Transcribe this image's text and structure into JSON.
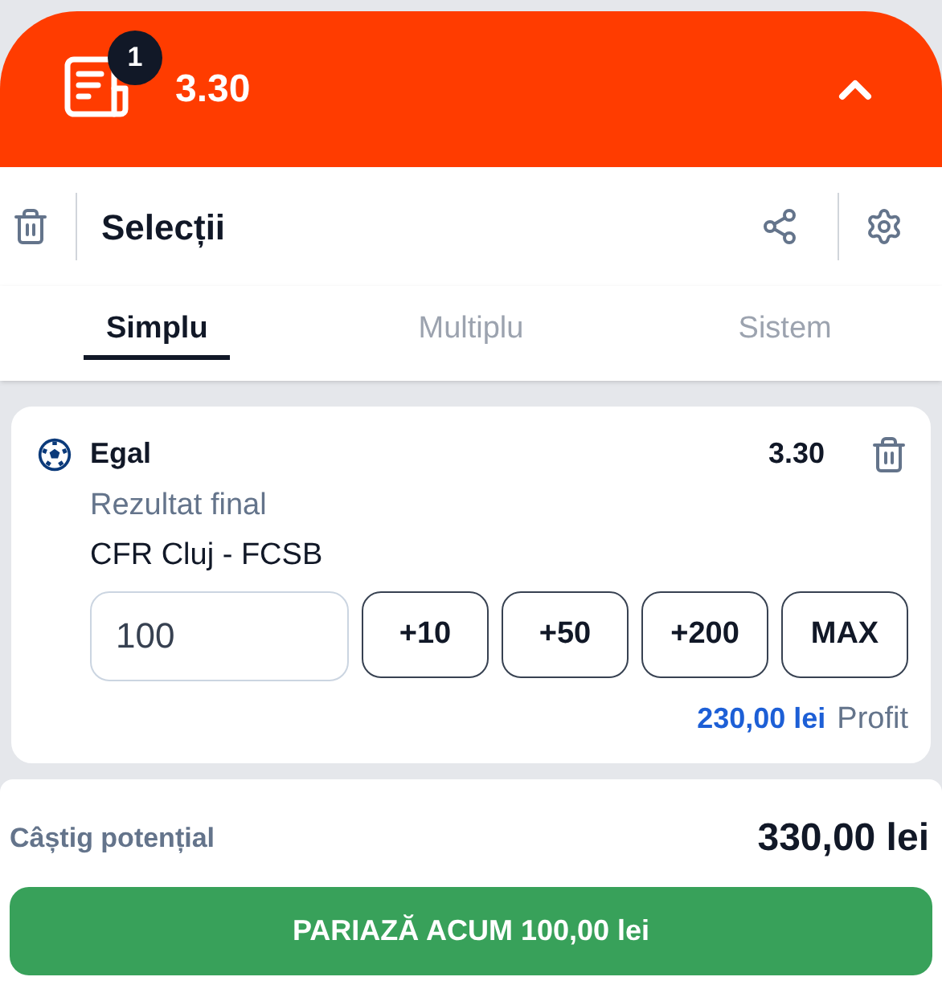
{
  "header": {
    "badge": "1",
    "odds": "3.30",
    "expanded": true
  },
  "toolbar": {
    "title": "Selecții"
  },
  "tabs": [
    {
      "label": "Simplu",
      "selected": true
    },
    {
      "label": "Multiplu",
      "selected": false
    },
    {
      "label": "Sistem",
      "selected": false
    }
  ],
  "selections": [
    {
      "pick": "Egal",
      "odds": "3.30",
      "market": "Rezultat final",
      "event": "CFR Cluj - FCSB",
      "stake": "100",
      "quick_stakes": [
        "+10",
        "+50",
        "+200",
        "MAX"
      ],
      "profit": "230,00 lei",
      "profit_label": "Profit"
    }
  ],
  "footer": {
    "label": "Câștig potențial",
    "amount": "330,00 lei",
    "button": "PARIAZĂ ACUM 100,00 lei"
  }
}
